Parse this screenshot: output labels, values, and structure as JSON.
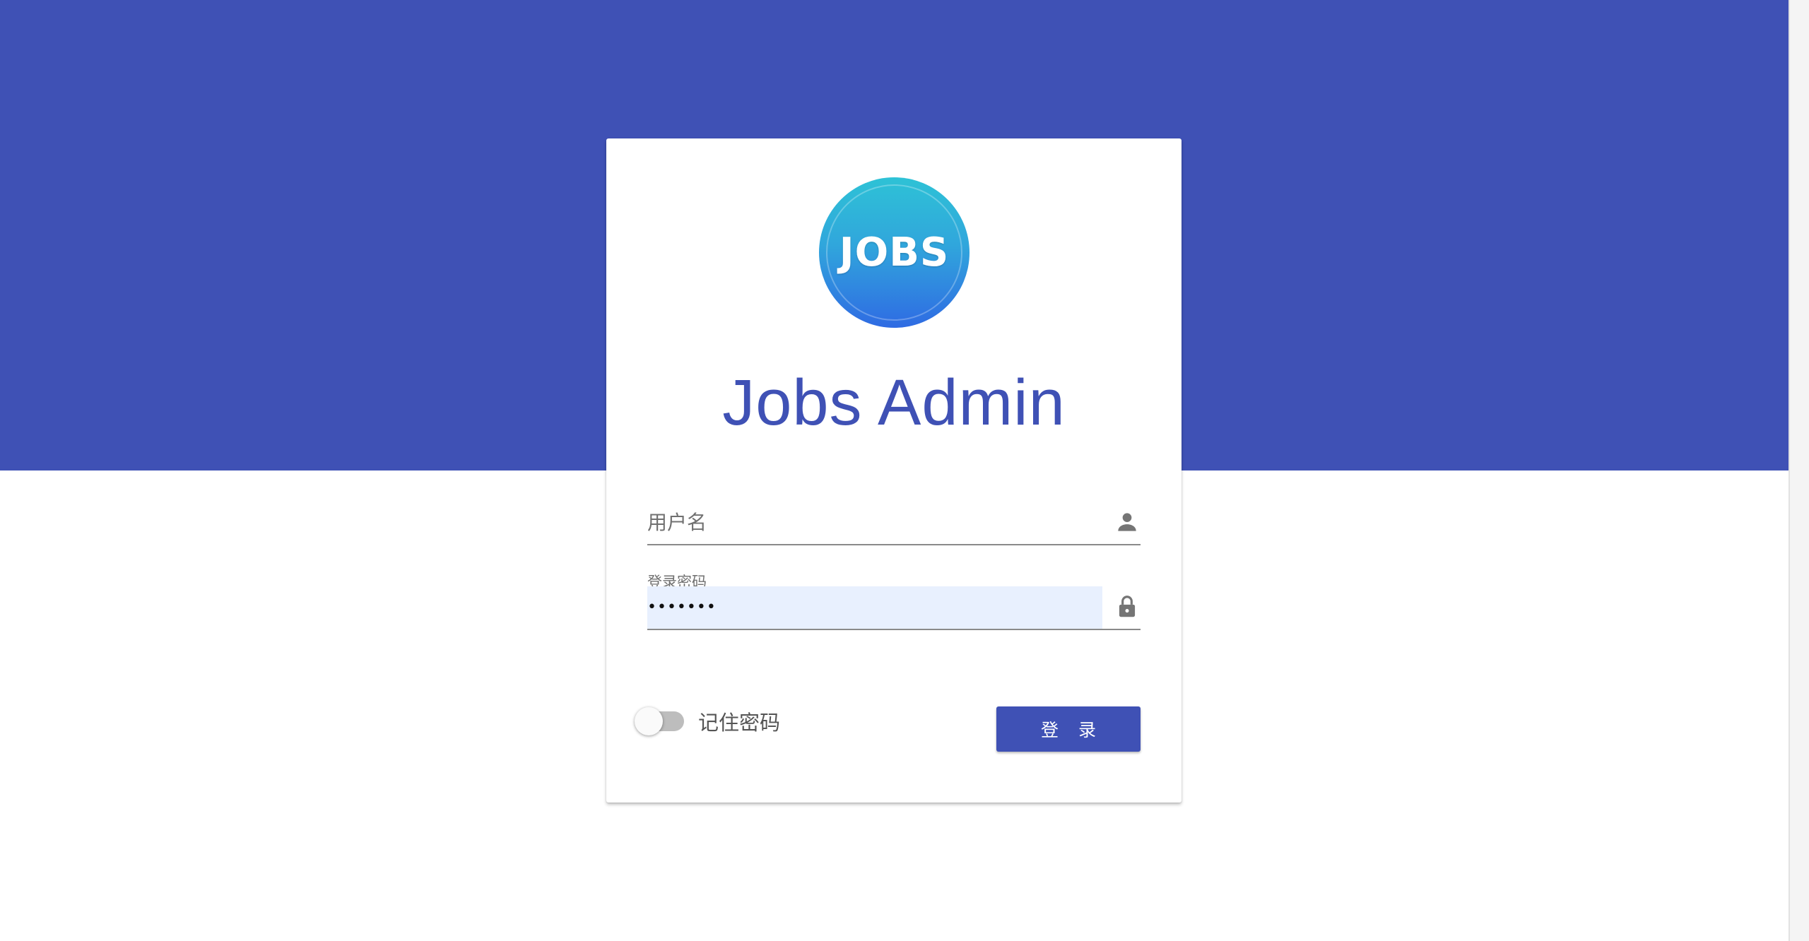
{
  "logo": {
    "text": "JOBS",
    "gradient": [
      "#2ec2d6",
      "#2f6be3"
    ]
  },
  "app": {
    "title": "Jobs Admin"
  },
  "form": {
    "username": {
      "placeholder": "用户名",
      "value": "",
      "icon": "person-icon"
    },
    "password": {
      "label": "登录密码",
      "value": "•••••••",
      "icon": "lock-icon"
    },
    "remember": {
      "label": "记住密码",
      "checked": false
    },
    "submit_label": "登 录"
  },
  "colors": {
    "primary": "#3f51b5",
    "autofill": "#e8f0fe",
    "icon": "#757575"
  }
}
